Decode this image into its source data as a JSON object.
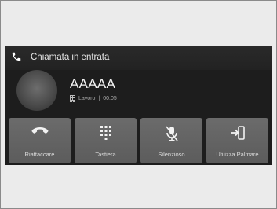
{
  "call": {
    "title": "Chiamata in entrata",
    "caller_name": "AAAAA",
    "caller_type": "Lavoro",
    "separator": "|",
    "duration": "00:05"
  },
  "actions": [
    {
      "label": "Riattaccare",
      "icon": "hang-up-icon"
    },
    {
      "label": "Tastiera",
      "icon": "keypad-icon"
    },
    {
      "label": "Silenzioso",
      "icon": "mute-microphone-icon"
    },
    {
      "label": "Utilizza Palmare",
      "icon": "transfer-to-handset-icon"
    }
  ],
  "colors": {
    "screen_bg": "#1d1d1d",
    "button_bg": "#666666",
    "text_light": "#e6e6e6"
  }
}
